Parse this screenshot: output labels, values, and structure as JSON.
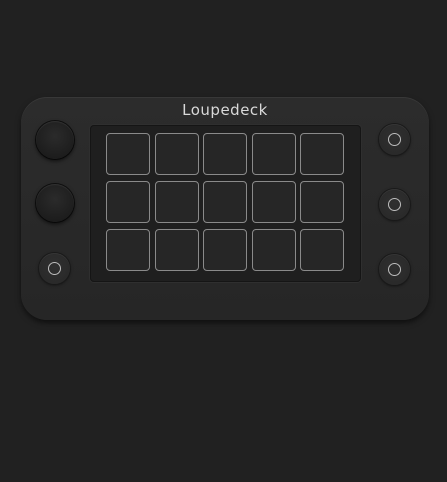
{
  "device": {
    "brand": "Loupedeck",
    "touch_keys": {
      "rows": 3,
      "cols": 5
    },
    "colors": {
      "background": "#212121",
      "body": "#2a2a2a",
      "key_border": "#8a8a8a"
    },
    "left_controls": [
      "dial",
      "dial",
      "button"
    ],
    "right_controls": [
      "button",
      "button",
      "button"
    ]
  }
}
